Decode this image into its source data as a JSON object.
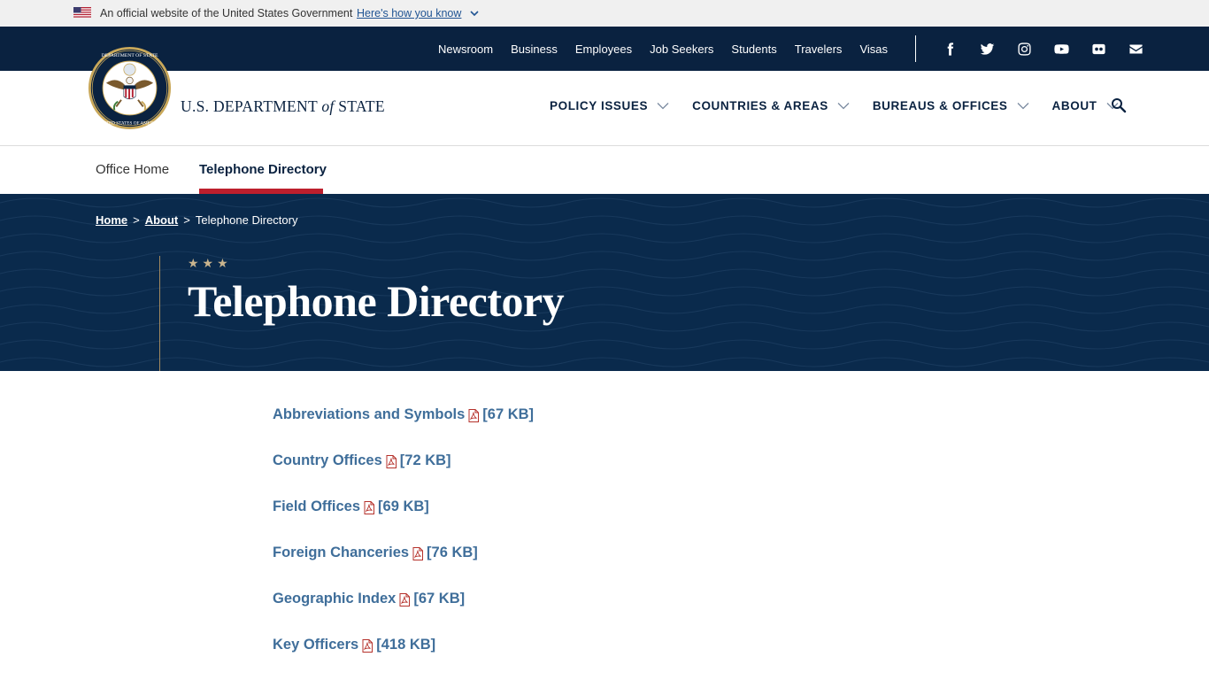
{
  "gov_banner": {
    "text": "An official website of the United States Government",
    "link": "Here's how you know"
  },
  "top_links": [
    "Newsroom",
    "Business",
    "Employees",
    "Job Seekers",
    "Students",
    "Travelers",
    "Visas"
  ],
  "social_icons": [
    "facebook-icon",
    "twitter-icon",
    "instagram-icon",
    "youtube-icon",
    "flickr-icon",
    "email-icon"
  ],
  "header": {
    "dept_prefix": "U.S. DEPARTMENT ",
    "dept_of": "of",
    "dept_suffix": " STATE",
    "nav": [
      "POLICY ISSUES",
      "COUNTRIES & AREAS",
      "BUREAUS & OFFICES",
      "ABOUT"
    ]
  },
  "subnav": {
    "home": "Office Home",
    "active": "Telephone Directory"
  },
  "breadcrumb": {
    "home": "Home",
    "sep": ">",
    "about": "About",
    "current": "Telephone Directory"
  },
  "hero": {
    "stars": "★★★",
    "title": "Telephone Directory"
  },
  "documents": [
    {
      "name": "Abbreviations and Symbols",
      "size": "[67 KB]"
    },
    {
      "name": "Country Offices",
      "size": "[72 KB]"
    },
    {
      "name": "Field Offices",
      "size": "[69 KB]"
    },
    {
      "name": "Foreign Chanceries",
      "size": "[76 KB]"
    },
    {
      "name": "Geographic Index",
      "size": "[67 KB]"
    },
    {
      "name": "Key Officers",
      "size": "[418 KB]"
    }
  ],
  "colors": {
    "navy": "#0a2240",
    "hero": "#0a2a4c",
    "accent_red": "#bd1f2d",
    "link_blue": "#3f6e9a",
    "gold": "#a38a60"
  }
}
